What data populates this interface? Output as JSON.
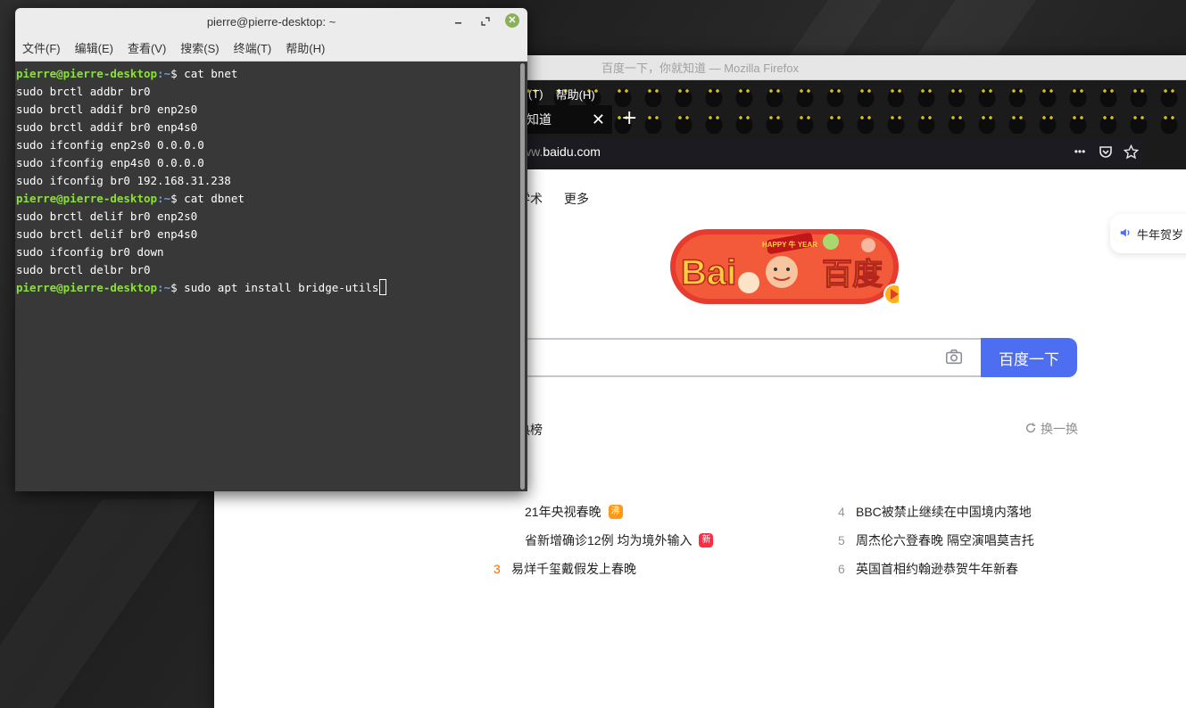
{
  "terminal": {
    "title": "pierre@pierre-desktop: ~",
    "menu": [
      "文件(F)",
      "编辑(E)",
      "查看(V)",
      "搜索(S)",
      "终端(T)",
      "帮助(H)"
    ],
    "prompt_user": "pierre@pierre-desktop",
    "prompt_path": ":~",
    "prompt_symbol": "$ ",
    "commands": [
      "cat bnet",
      "cat dbnet",
      "sudo apt install bridge-utils"
    ],
    "output_bnet": [
      "sudo brctl addbr br0",
      "sudo brctl addif br0 enp2s0",
      "sudo brctl addif br0 enp4s0",
      "sudo ifconfig enp2s0 0.0.0.0",
      "sudo ifconfig enp4s0 0.0.0.0",
      "sudo ifconfig br0 192.168.31.238"
    ],
    "output_dbnet": [
      "sudo brctl delif br0 enp2s0",
      "sudo brctl delif br0 enp4s0",
      "sudo ifconfig br0 down",
      "sudo brctl delbr br0"
    ]
  },
  "firefox": {
    "title": "百度一下，你就知道 — Mozilla Firefox",
    "menu_visible": [
      "(T)",
      "帮助(H)"
    ],
    "tab_label": "知道",
    "tab_close": "✕",
    "new_tab": "+",
    "url_prefix": "ww.",
    "url_domain": "baidu.com",
    "url_more": "•••"
  },
  "baidu": {
    "nav": [
      "",
      "学术",
      "更多"
    ],
    "logo_text_left": "Bai",
    "logo_text_right": "百度",
    "logo_banner": "HAPPY 牛 YEAR",
    "search_placeholder": "",
    "search_button": "百度一下",
    "hot_title": "热榜",
    "refresh_label": "换一换",
    "side_pill": "牛年贺岁",
    "hot_items": [
      {
        "rank": "",
        "text": "21年央视春晚",
        "badge": "沸"
      },
      {
        "rank": "4",
        "text": "BBC被禁止继续在中国境内落地",
        "badge": ""
      },
      {
        "rank": "",
        "text": "省新增确诊12例 均为境外输入",
        "badge": "新"
      },
      {
        "rank": "5",
        "text": "周杰伦六登春晚 隔空演唱莫吉托",
        "badge": ""
      },
      {
        "rank": "3",
        "text": "易烊千玺戴假发上春晚",
        "badge": ""
      },
      {
        "rank": "6",
        "text": "英国首相约翰逊恭贺牛年新春",
        "badge": ""
      }
    ]
  },
  "colors": {
    "baidu_blue": "#4e6ef2",
    "prompt_green": "#8ae234",
    "prompt_blue": "#729fcf",
    "terminal_bg": "#383838",
    "badge_hot": "#ff9812",
    "badge_new": "#fe2d46"
  }
}
